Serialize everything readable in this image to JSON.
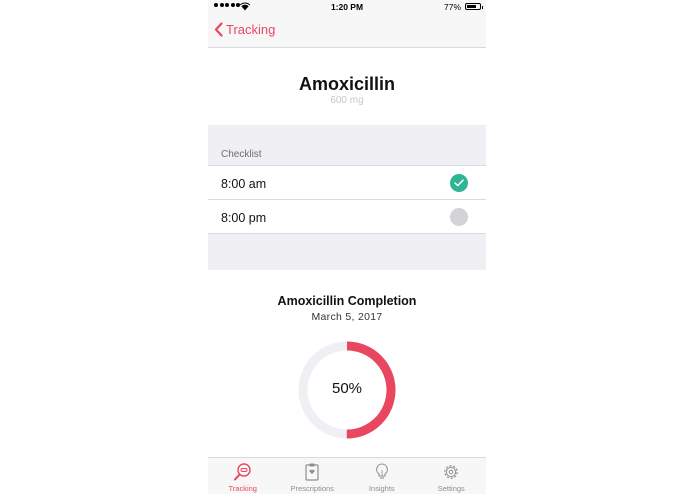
{
  "status_bar": {
    "time": "1:20 PM",
    "battery_percent": "77%",
    "battery_level": 0.77
  },
  "nav": {
    "back_label": "Tracking"
  },
  "medication": {
    "name": "Amoxicillin",
    "dose": "600 mg"
  },
  "checklist": {
    "header": "Checklist",
    "items": [
      {
        "time": "8:00 am",
        "status": "done"
      },
      {
        "time": "8:00 pm",
        "status": "pending"
      }
    ]
  },
  "completion": {
    "title": "Amoxicillin Completion",
    "date": "March 5, 2017",
    "percent_label": "50%",
    "progress": 0.5
  },
  "tabs": [
    {
      "label": "Tracking",
      "icon": "magnifier-pill-icon",
      "active": true
    },
    {
      "label": "Prescriptions",
      "icon": "clipboard-icon",
      "active": false
    },
    {
      "label": "Insights",
      "icon": "lightbulb-icon",
      "active": false
    },
    {
      "label": "Settings",
      "icon": "gear-icon",
      "active": false
    }
  ],
  "colors": {
    "accent": "#e8475f",
    "done": "#2fb594",
    "pending": "#d4d4d6",
    "ring_track": "#efeff4"
  }
}
